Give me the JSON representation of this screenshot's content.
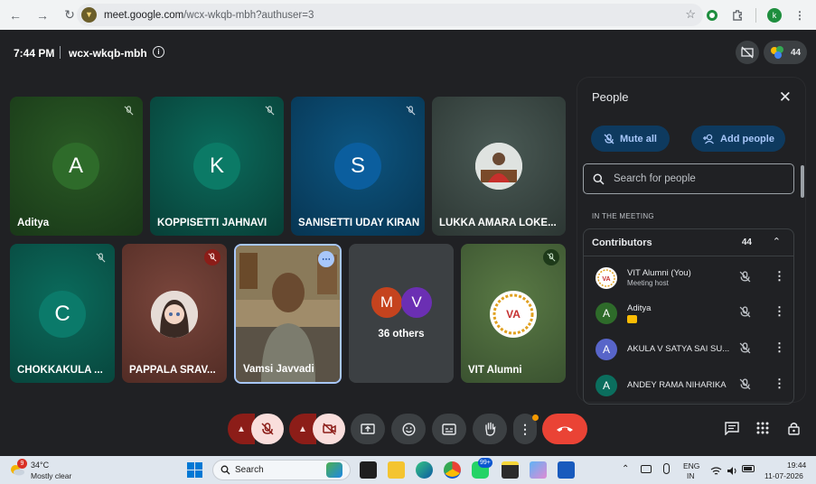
{
  "browser": {
    "url_host": "meet.google.com",
    "url_path": "/wcx-wkqb-mbh?authuser=3",
    "profile_initial": "k"
  },
  "meeting": {
    "time": "7:44 PM",
    "code": "wcx-wkqb-mbh",
    "participant_count": "44"
  },
  "tiles": [
    {
      "name": "Aditya",
      "initial": "A",
      "avatar_color": "#2e6b2a",
      "bg": "#244d22"
    },
    {
      "name": "KOPPISETTI JAHNAVI",
      "initial": "K",
      "avatar_color": "#0b7a66",
      "bg": "#0b5a4d"
    },
    {
      "name": "SANISETTI UDAY KIRAN",
      "initial": "S",
      "avatar_color": "#0b5e9e",
      "bg": "#0a4a70"
    },
    {
      "name": "LUKKA AMARA LOKE...",
      "initial": "",
      "avatar_color": "#e8e8e8",
      "bg": "#3a4a45"
    },
    {
      "name": "CHOKKAKULA ...",
      "initial": "C",
      "avatar_color": "#0b7a6a",
      "bg": "#0b5a55"
    },
    {
      "name": "PAPPALA SRAV...",
      "initial": "",
      "avatar_color": "#d9c8c0",
      "bg": "#6a3c34"
    },
    {
      "name": "Vamsi Javvadi",
      "initial": "",
      "avatar_color": "",
      "bg": "#6c6450"
    },
    {
      "name": "36 others",
      "initial": "",
      "avatar_color": "",
      "bg": "#3c4043"
    },
    {
      "name": "VIT Alumni",
      "initial": "",
      "avatar_color": "#ffffff",
      "bg": "#4a6a3a"
    }
  ],
  "others_avatars": [
    {
      "initial": "M",
      "color": "#c5431e"
    },
    {
      "initial": "V",
      "color": "#6b2fb3"
    }
  ],
  "people_panel": {
    "title": "People",
    "mute_all_label": "Mute all",
    "add_people_label": "Add people",
    "search_placeholder": "Search for people",
    "section_label": "IN THE MEETING",
    "group_title": "Contributors",
    "group_count": "44",
    "people": [
      {
        "name": "VIT Alumni (You)",
        "sub": "Meeting host",
        "initial": "",
        "color": "#ffffff"
      },
      {
        "name": "Aditya",
        "sub": "",
        "initial": "A",
        "color": "#2e6b2a"
      },
      {
        "name": "AKULA V SATYA SAI SU...",
        "sub": "",
        "initial": "A",
        "color": "#5865c9"
      },
      {
        "name": "ANDEY RAMA NIHARIKA",
        "sub": "",
        "initial": "A",
        "color": "#0b6e5e"
      }
    ]
  },
  "taskbar": {
    "temp": "34°C",
    "weather": "Mostly clear",
    "weather_badge": "9",
    "search_label": "Search",
    "whatsapp_badge": "99+",
    "lang1": "ENG",
    "lang2": "IN",
    "clock_time": "19:44",
    "clock_date": "11-07-2026"
  },
  "colors": {
    "end_call": "#ea4335",
    "muted_btn": "#f9dedc",
    "muted_dark": "#8c1d18",
    "control_bg": "#3c4043"
  }
}
